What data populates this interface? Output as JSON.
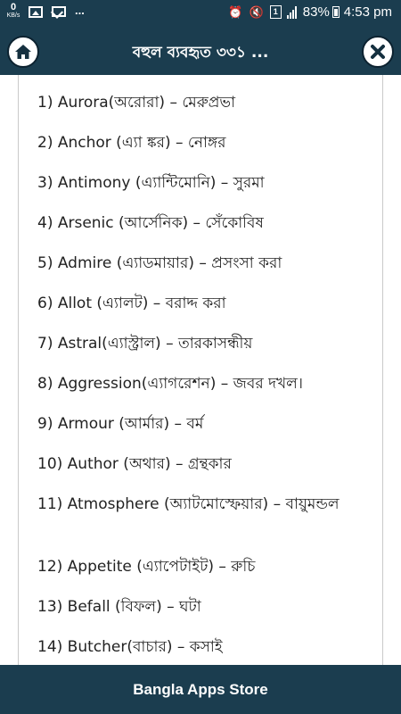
{
  "status_bar": {
    "net_speed_value": "0",
    "net_speed_unit": "KB/s",
    "notification_icons": [
      "image-icon",
      "mail-icon"
    ],
    "overflow": "...",
    "sim_slot": "1",
    "battery_percent": "83%",
    "time": "4:53 pm"
  },
  "header": {
    "title": "বহুল ব্যবহৃত ৩৩১ ..."
  },
  "words": [
    "1) Aurora(অরোরা) – মেরুপ্রভা",
    "2) Anchor (এ্যা ঙ্কর) – নোঙ্গর",
    "3) Antimony (এ্যান্টিমোনি) – সুরমা",
    "4) Arsenic (আর্সেনিক) – সেঁকোবিষ",
    "5) Admire (এ্যাডমায়ার) – প্রসংসা করা",
    "6) Allot (এ্যালট) – বরাদ্দ করা",
    "7) Astral(এ্যাস্ট্রাল) – তারকাসন্ধীয়",
    "8) Aggression(এ্যাগরেশন) – জবর দখল।",
    "9) Armour (আর্মার) – বর্ম",
    "10) Author (অথার) – গ্রন্থকার",
    "11) Atmosphere (অ্যাটমোস্ফেয়ার) – বায়ুমন্ডল",
    "12) Appetite (এ্যাপেটাইট) – রুচি",
    "13) Befall (বিফল) – ঘটা",
    "14) Butcher(বাচার) – কসাই"
  ],
  "footer": {
    "label": "Bangla Apps Store"
  }
}
